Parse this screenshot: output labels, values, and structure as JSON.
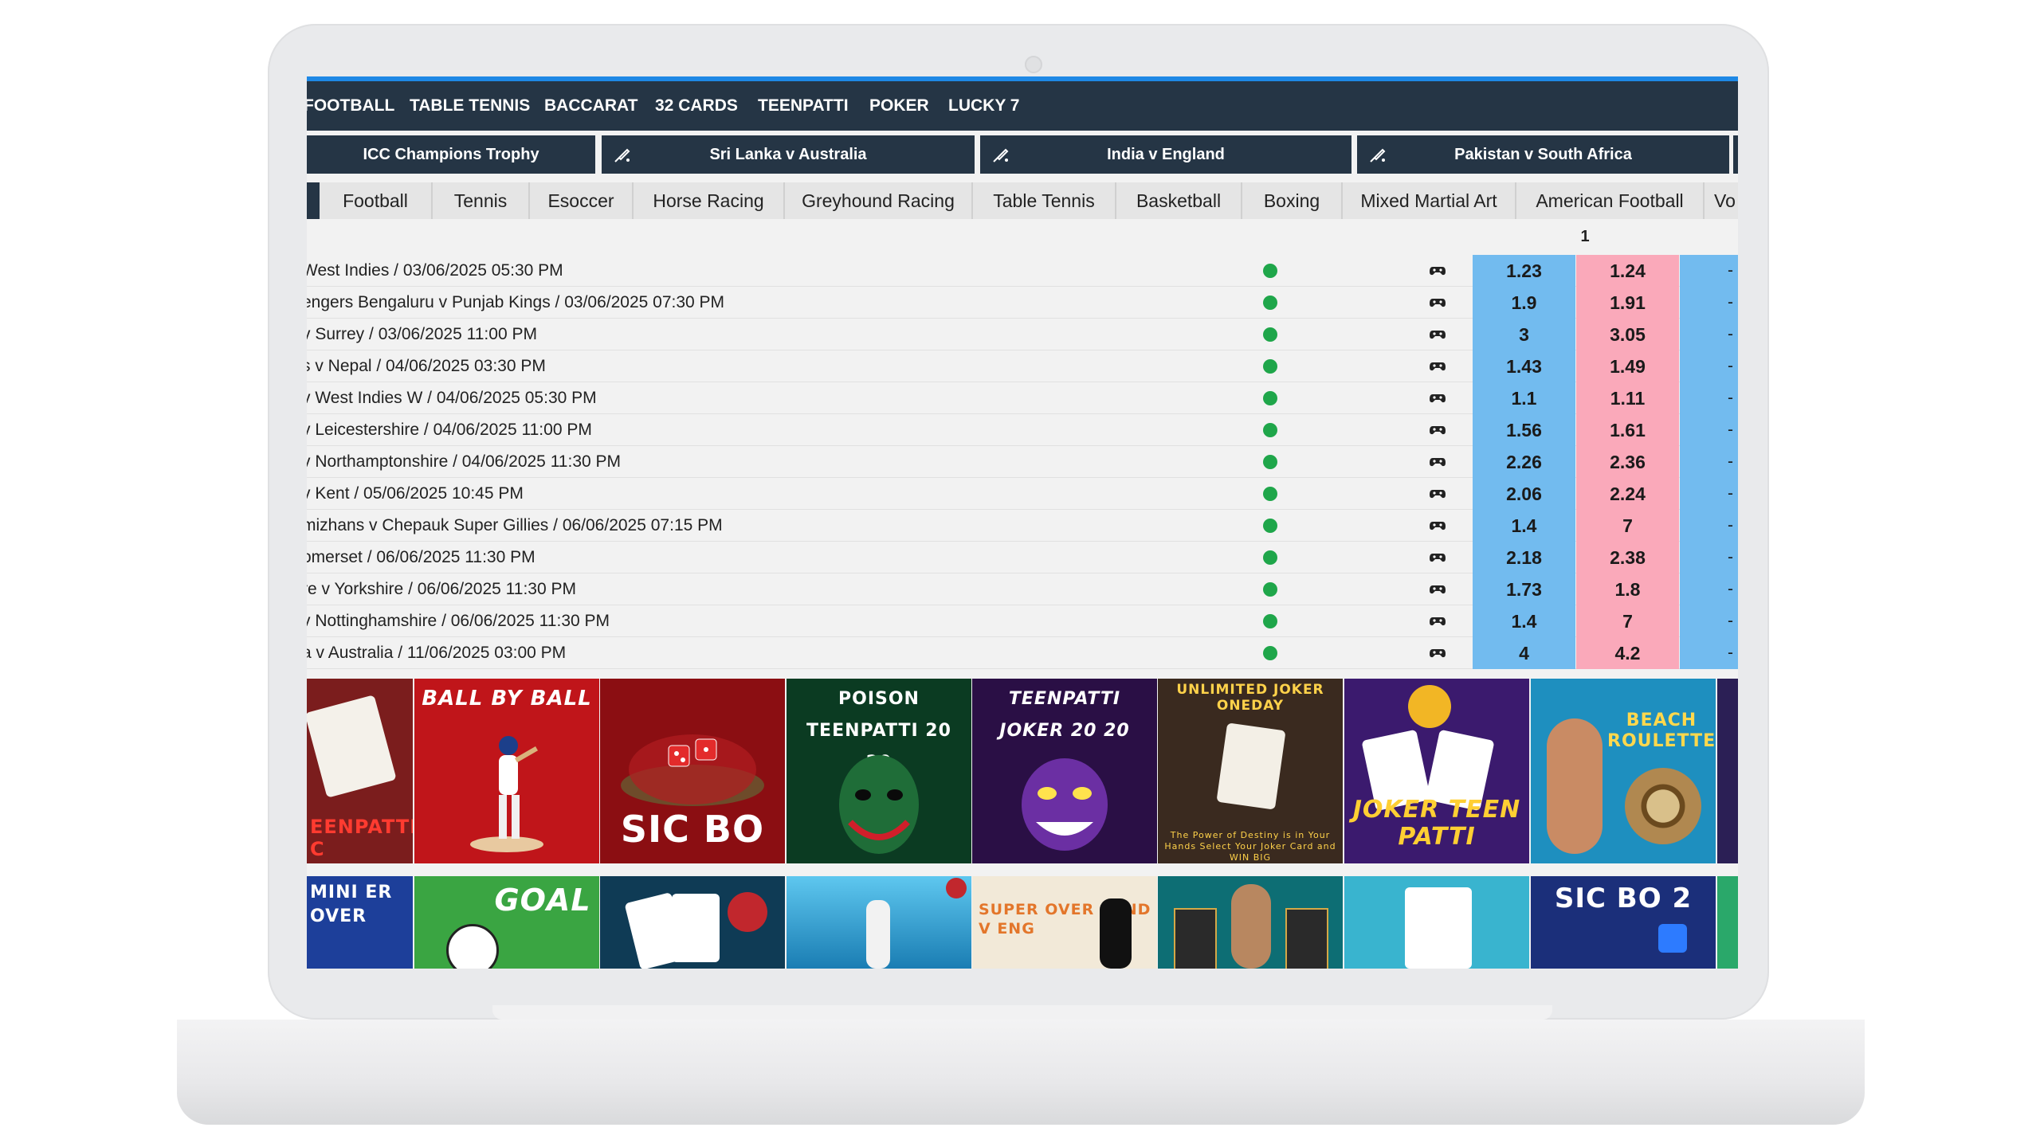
{
  "nav": {
    "items": [
      "FOOTBALL",
      "TABLE TENNIS",
      "BACCARAT",
      "32 CARDS",
      "TEENPATTI",
      "POKER",
      "LUCKY 7"
    ]
  },
  "events": [
    {
      "label": "ICC Champions Trophy"
    },
    {
      "label": "Sri Lanka v Australia"
    },
    {
      "label": "India v England"
    },
    {
      "label": "Pakistan v South Africa"
    }
  ],
  "sports": [
    "Football",
    "Tennis",
    "Esoccer",
    "Horse Racing",
    "Greyhound Racing",
    "Table Tennis",
    "Basketball",
    "Boxing",
    "Mixed Martial Art",
    "American Football",
    "Vo"
  ],
  "table": {
    "header_one": "1",
    "matches": [
      {
        "name": "West Indies  / 03/06/2025 05:30 PM",
        "back": "1.23",
        "lay": "1.24",
        "back2": "-"
      },
      {
        "name": "engers Bengaluru v Punjab Kings  / 03/06/2025 07:30 PM",
        "back": "1.9",
        "lay": "1.91",
        "back2": "-"
      },
      {
        "name": "v Surrey  / 03/06/2025 11:00 PM",
        "back": "3",
        "lay": "3.05",
        "back2": "-"
      },
      {
        "name": "s v Nepal  / 04/06/2025 03:30 PM",
        "back": "1.43",
        "lay": "1.49",
        "back2": "-"
      },
      {
        "name": "v West Indies W  / 04/06/2025 05:30 PM",
        "back": "1.1",
        "lay": "1.11",
        "back2": "-"
      },
      {
        "name": "v Leicestershire  / 04/06/2025 11:00 PM",
        "back": "1.56",
        "lay": "1.61",
        "back2": "-"
      },
      {
        "name": "v Northamptonshire  / 04/06/2025 11:30 PM",
        "back": "2.26",
        "lay": "2.36",
        "back2": "-"
      },
      {
        "name": "v Kent  / 05/06/2025 10:45 PM",
        "back": "2.06",
        "lay": "2.24",
        "back2": "-"
      },
      {
        "name": "mizhans v Chepauk Super Gillies  / 06/06/2025 07:15 PM",
        "back": "1.4",
        "lay": "7",
        "back2": "-"
      },
      {
        "name": "omerset  / 06/06/2025 11:30 PM",
        "back": "2.18",
        "lay": "2.38",
        "back2": "-"
      },
      {
        "name": "re v Yorkshire  / 06/06/2025 11:30 PM",
        "back": "1.73",
        "lay": "1.8",
        "back2": "-"
      },
      {
        "name": "v Nottinghamshire  / 06/06/2025 11:30 PM",
        "back": "1.4",
        "lay": "7",
        "back2": "-"
      },
      {
        "name": "a v Australia  / 11/06/2025 03:00 PM",
        "back": "4",
        "lay": "4.2",
        "back2": "-"
      }
    ]
  },
  "games_row1": [
    {
      "title": "EENPATTI C",
      "bg": "#7b1d1d"
    },
    {
      "title": "BALL BY BALL",
      "bg": "#c0151a"
    },
    {
      "title": "SIC BO",
      "bg": "#8b0e12"
    },
    {
      "title": "POISON TEENPATTI 20 20",
      "bg": "#0b3b22"
    },
    {
      "title": "TEENPATTI JOKER 20 20",
      "bg": "#2a0f45"
    },
    {
      "title": "UNLIMITED JOKER ONEDAY",
      "sub": "The Power of Destiny is in Your Hands Select Your Joker Card and WIN BIG",
      "bg": "#3a2a1f"
    },
    {
      "title": "JOKER TEEN PATTI",
      "bg": "#3b1a6e"
    },
    {
      "title": "BEACH ROULETTE",
      "bg": "#1e8fbf"
    }
  ],
  "games_row2": [
    {
      "title": "MINI ER OVER",
      "bg": "#1d3f9a"
    },
    {
      "title": "GOAL",
      "bg": "#3aa542"
    },
    {
      "title": "",
      "bg": "#0f3b55"
    },
    {
      "title": "",
      "bg": "#2aa8d8"
    },
    {
      "title": "SUPER OVER 2 IND V ENG",
      "bg": "#f2e9d8"
    },
    {
      "title": "",
      "bg": "#0d6e74"
    },
    {
      "title": "",
      "bg": "#39b4cf"
    },
    {
      "title": "SIC BO 2",
      "bg": "#1b2f7a"
    }
  ]
}
